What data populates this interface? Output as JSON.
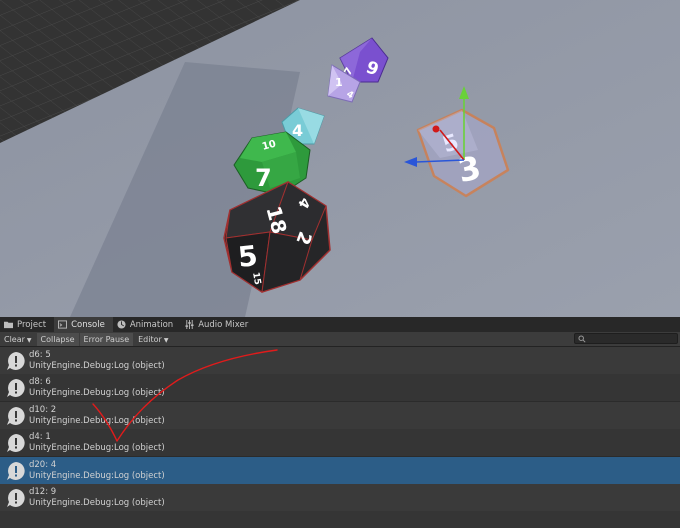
{
  "scene": {
    "dice": [
      {
        "name": "d20",
        "face_main": "5",
        "face_top": "18",
        "face_right": "2",
        "face_top_right": "4",
        "face_bottom": "15",
        "color": "#262628"
      },
      {
        "name": "d12",
        "face_main": "7",
        "face_top": "10",
        "color": "#2e9a3c"
      },
      {
        "name": "d4",
        "face_main": "4",
        "color": "#79ccd6"
      },
      {
        "name": "d8",
        "face_main": "1",
        "face_side": "4",
        "color": "#b7a4e6"
      },
      {
        "name": "d10",
        "face_main": "9",
        "face_side": "7",
        "color": "#7a50cf"
      },
      {
        "name": "d6",
        "face_main": "3",
        "face_top": "5",
        "color": "#a9a9cf"
      }
    ],
    "colors": {
      "ground": "#9096a3",
      "grid": "#3e3e3e",
      "selection": "#f07020",
      "gizmo_y": "#6ad13a",
      "gizmo_x": "#d11a1a",
      "gizmo_z": "#2a56d8"
    }
  },
  "tabs": [
    {
      "label": "Project",
      "icon": "folder-icon",
      "active": false
    },
    {
      "label": "Console",
      "icon": "console-icon",
      "active": true
    },
    {
      "label": "Animation",
      "icon": "animation-icon",
      "active": false
    },
    {
      "label": "Audio Mixer",
      "icon": "audio-mixer-icon",
      "active": false
    }
  ],
  "toolbar": {
    "clear": "Clear",
    "collapse": "Collapse",
    "error_pause": "Error Pause",
    "editor": "Editor",
    "search_placeholder": ""
  },
  "logs": [
    {
      "message": "d6: 5",
      "source": "UnityEngine.Debug:Log (object)",
      "selected": false
    },
    {
      "message": "d8: 6",
      "source": "UnityEngine.Debug:Log (object)",
      "selected": false
    },
    {
      "message": "d10: 2",
      "source": "UnityEngine.Debug:Log (object)",
      "selected": false
    },
    {
      "message": "d4: 1",
      "source": "UnityEngine.Debug:Log (object)",
      "selected": false
    },
    {
      "message": "d20: 4",
      "source": "UnityEngine.Debug:Log (object)",
      "selected": true
    },
    {
      "message": "d12: 9",
      "source": "UnityEngine.Debug:Log (object)",
      "selected": false
    }
  ],
  "annotation_color": "#e01b1b"
}
